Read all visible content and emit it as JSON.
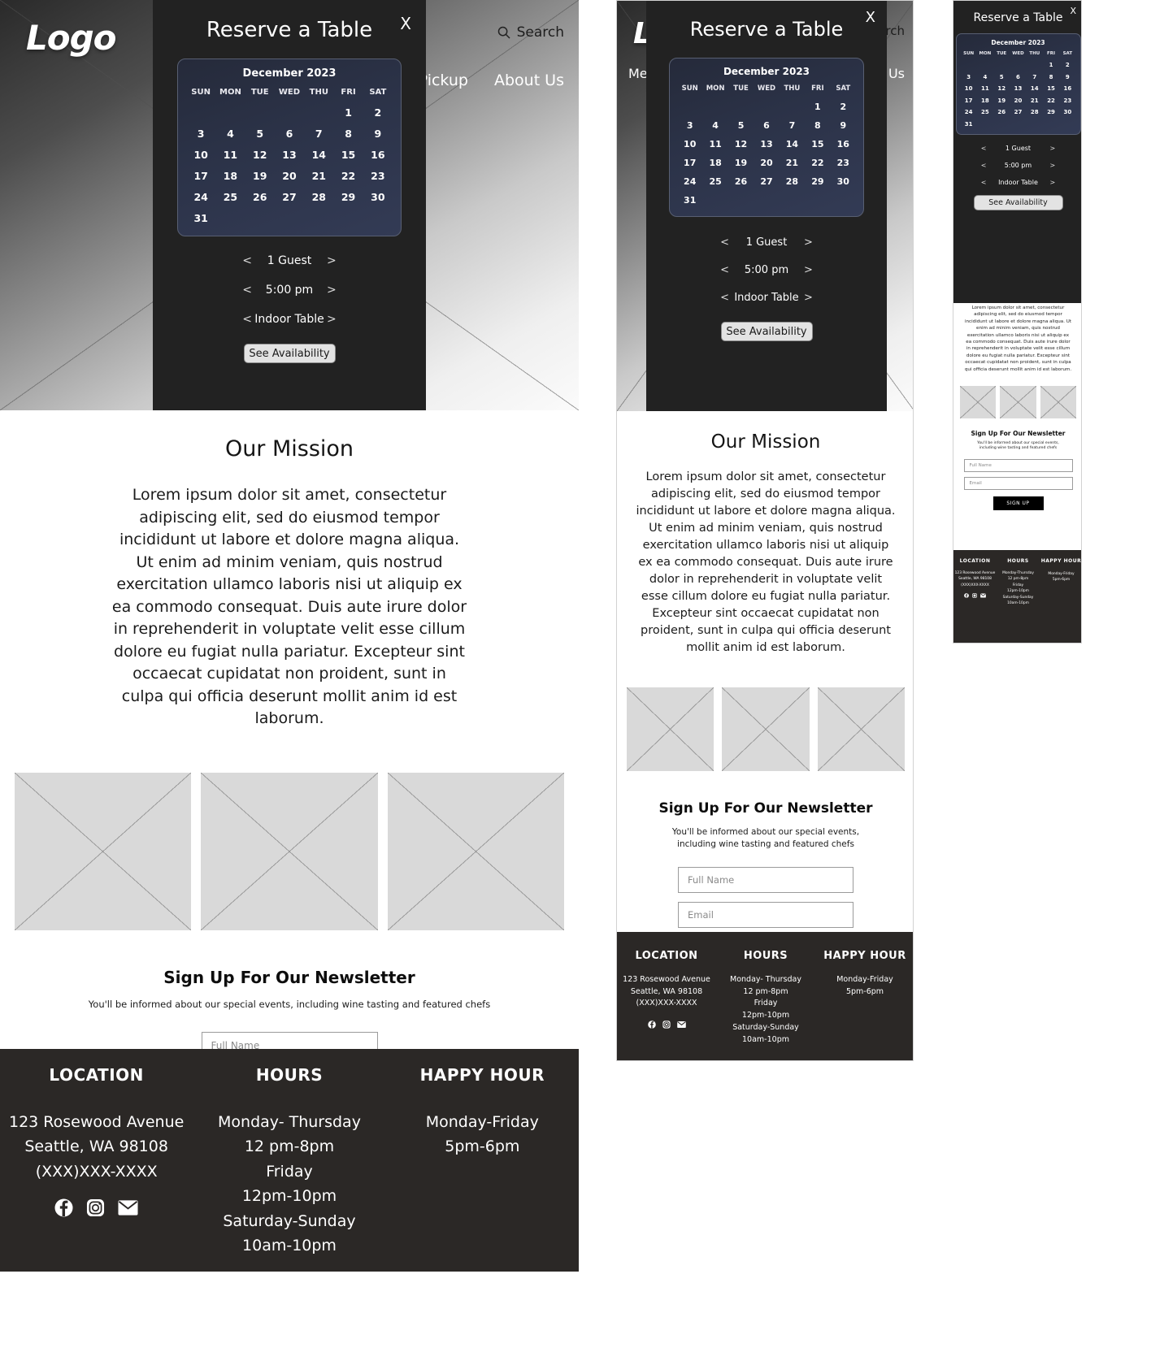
{
  "brand": {
    "logo_text": "Logo"
  },
  "header": {
    "search_label": "Search",
    "search_icon": "search-icon",
    "nav": [
      {
        "label": "Menu"
      },
      {
        "label": "Pickup"
      },
      {
        "label": "About Us"
      }
    ]
  },
  "modal": {
    "title": "Reserve a Table",
    "close_label": "X",
    "calendar": {
      "month_label": "December 2023",
      "weekdays": [
        "SUN",
        "MON",
        "TUE",
        "WED",
        "THU",
        "FRI",
        "SAT"
      ],
      "lead_blanks": 5,
      "days": [
        1,
        2,
        3,
        4,
        5,
        6,
        7,
        8,
        9,
        10,
        11,
        12,
        13,
        14,
        15,
        16,
        17,
        18,
        19,
        20,
        21,
        22,
        23,
        24,
        25,
        26,
        27,
        28,
        29,
        30,
        31
      ]
    },
    "steppers": [
      {
        "name": "guests",
        "prev": "<",
        "value": "1 Guest",
        "next": ">"
      },
      {
        "name": "time",
        "prev": "<",
        "value": "5:00 pm",
        "next": ">"
      },
      {
        "name": "seating",
        "prev": "<",
        "value": "Indoor Table",
        "next": ">"
      }
    ],
    "cta_label": "See Availability"
  },
  "mission": {
    "heading": "Our Mission",
    "body": "Lorem ipsum dolor sit amet, consectetur adipiscing elit, sed do eiusmod tempor incididunt ut labore et dolore magna aliqua. Ut enim ad minim veniam, quis nostrud exercitation ullamco laboris nisi ut aliquip ex ea commodo consequat. Duis aute irure dolor in reprehenderit in voluptate velit esse cillum dolore eu fugiat nulla pariatur. Excepteur sint occaecat cupidatat non proident, sunt in culpa qui officia deserunt mollit anim id est laborum."
  },
  "gallery": {
    "items": [
      "image-placeholder-1",
      "image-placeholder-2",
      "image-placeholder-3"
    ]
  },
  "newsletter": {
    "heading": "Sign Up For Our Newsletter",
    "subheading": "You'll be informed about our special events, including wine tasting and featured chefs",
    "name_placeholder": "Full Name",
    "email_placeholder": "Email",
    "button_label": "SIGN UP"
  },
  "footer": {
    "columns": [
      {
        "title": "LOCATION",
        "lines": [
          "123 Rosewood Avenue",
          "Seattle, WA 98108",
          "(XXX)XXX-XXXX"
        ],
        "title_mobile": "LOCATION",
        "lines_mobile": [
          "123 Rosewood Avenue",
          "Seattle, WA 98108",
          "(XXX)XXX-XXXX"
        ]
      },
      {
        "title": "HOURS",
        "lines": [
          "Monday- Thursday",
          "12 pm-8pm",
          "Friday",
          "12pm-10pm",
          "Saturday-Sunday",
          "10am-10pm"
        ],
        "title_mobile": "HOURS",
        "lines_mobile": [
          "Monday-Thursday",
          "12 pm-8pm",
          "Friday",
          "12pm-10pm",
          "Saturday-Sunday",
          "10am-10pm"
        ]
      },
      {
        "title": "HAPPY HOUR",
        "lines": [
          "Monday-Friday",
          "5pm-6pm"
        ],
        "title_mobile": "HAPPY HOUR",
        "lines_mobile": [
          "Monday-Friday",
          "5pm-6pm"
        ]
      }
    ],
    "socials": [
      "facebook-icon",
      "instagram-icon",
      "email-icon"
    ]
  },
  "colors": {
    "modal_bg": "#222222",
    "calendar_bg": "#2b3247",
    "footer_bg": "#2b2826",
    "cta_bg": "#e3e3e3",
    "signup_bg": "#000000"
  }
}
